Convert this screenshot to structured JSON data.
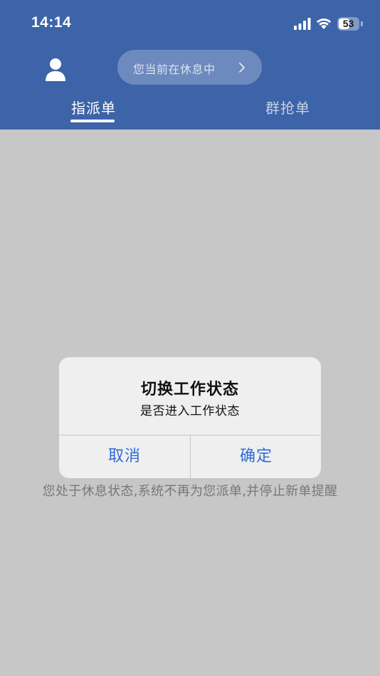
{
  "status_bar": {
    "time": "14:14",
    "battery": "53"
  },
  "header": {
    "status_pill": "您当前在休息中",
    "tabs": [
      {
        "label": "指派单",
        "active": true
      },
      {
        "label": "群抢单",
        "active": false
      }
    ]
  },
  "main": {
    "empty_message": "您处于休息状态,系统不再为您派单,并停止新单提醒"
  },
  "dialog": {
    "title": "切换工作状态",
    "message": "是否进入工作状态",
    "cancel_label": "取消",
    "confirm_label": "确定"
  },
  "colors": {
    "header_bg": "#3d63a8",
    "dialog_button": "#2f6bd6",
    "empty_text": "#9a9a9a"
  },
  "icons": {
    "avatar": "user-silhouette-icon",
    "pill_chevron": "chevron-right-icon",
    "signal": "cellular-signal-icon",
    "wifi": "wifi-icon",
    "battery": "battery-icon"
  }
}
